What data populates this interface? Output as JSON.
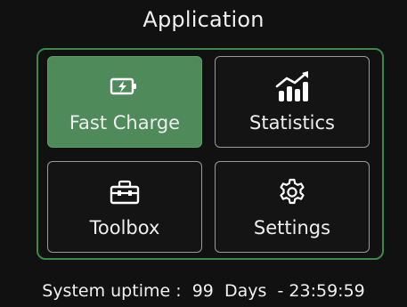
{
  "header": {
    "title": "Application"
  },
  "menu": {
    "items": [
      {
        "label": "Fast Charge",
        "icon": "battery-charging-icon",
        "selected": true
      },
      {
        "label": "Statistics",
        "icon": "bar-chart-trend-icon",
        "selected": false
      },
      {
        "label": "Toolbox",
        "icon": "toolbox-icon",
        "selected": false
      },
      {
        "label": "Settings",
        "icon": "gear-icon",
        "selected": false
      }
    ]
  },
  "footer": {
    "uptime_label": "System uptime :",
    "days_value": "99",
    "days_unit": "Days",
    "time": "- 23:59:59"
  },
  "colors": {
    "background": "#111111",
    "accent_green": "#4f8a5b",
    "panel_border": "#3a8a4a",
    "tile_border": "#9a9a9a",
    "text": "#f0f0f0"
  }
}
